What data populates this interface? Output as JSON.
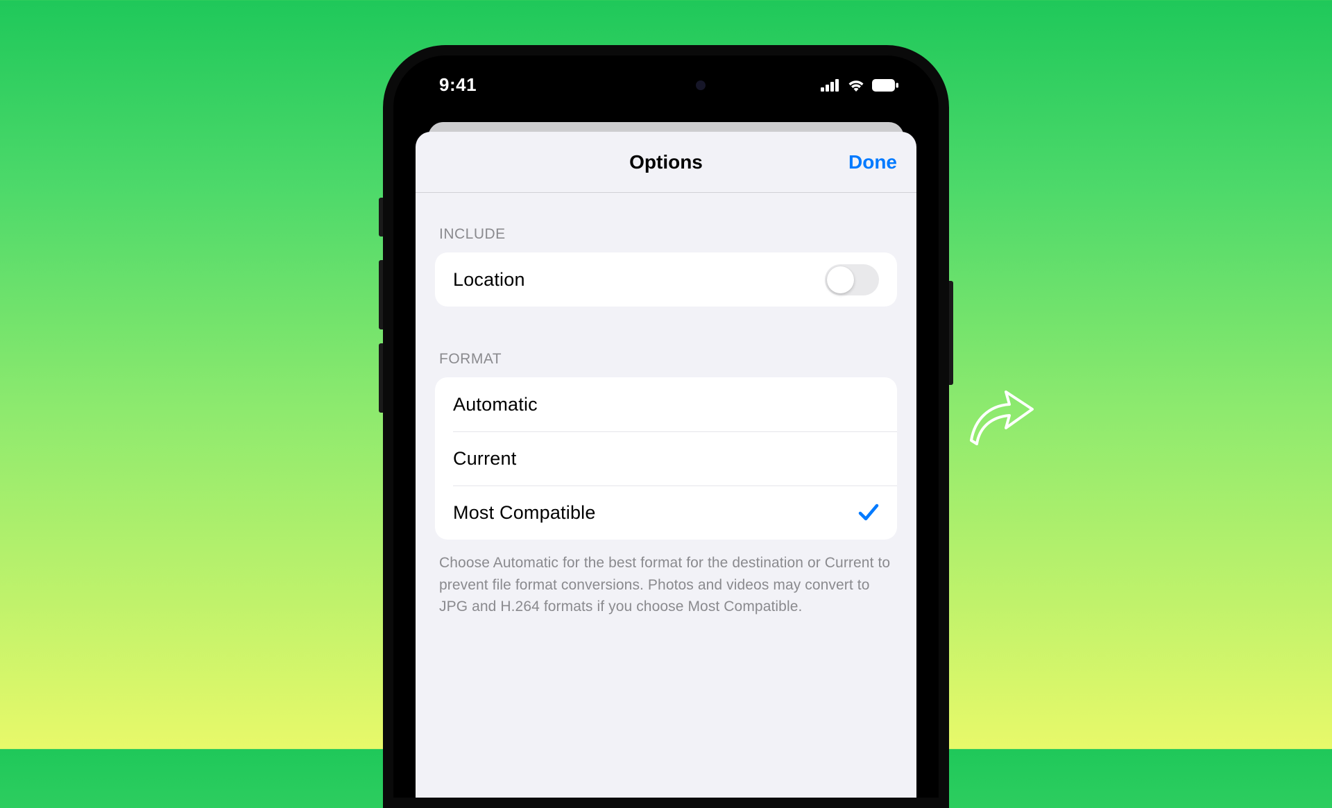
{
  "status": {
    "time": "9:41"
  },
  "sheet": {
    "title": "Options",
    "done_label": "Done"
  },
  "sections": {
    "include": {
      "header": "INCLUDE",
      "location_label": "Location",
      "location_on": false
    },
    "format": {
      "header": "FORMAT",
      "options": [
        {
          "label": "Automatic",
          "selected": false
        },
        {
          "label": "Current",
          "selected": false
        },
        {
          "label": "Most Compatible",
          "selected": true
        }
      ],
      "footer": "Choose Automatic for the best format for the destination or Current to prevent file format conversions. Photos and videos may convert to JPG and H.264 formats if you choose Most Compatible."
    }
  },
  "colors": {
    "accent": "#007aff"
  }
}
